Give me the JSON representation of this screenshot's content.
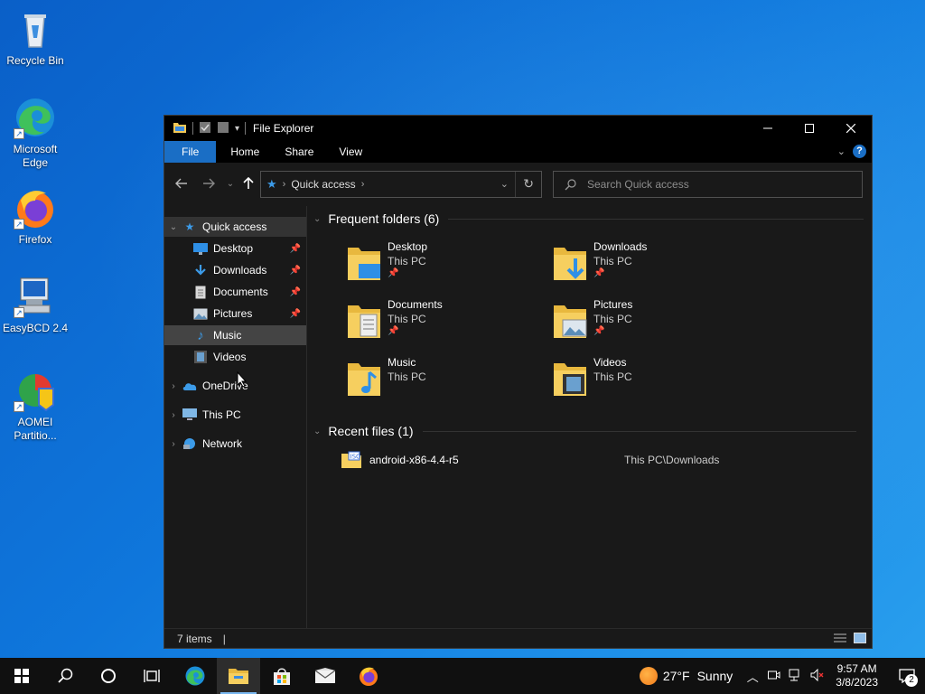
{
  "desktop": {
    "icons": [
      {
        "label": "Recycle Bin",
        "icon": "recycle-bin-icon"
      },
      {
        "label": "Microsoft Edge",
        "icon": "edge-icon"
      },
      {
        "label": "Firefox",
        "icon": "firefox-icon"
      },
      {
        "label": "EasyBCD 2.4",
        "icon": "easybcd-icon"
      },
      {
        "label": "AOMEI Partitio...",
        "icon": "aomei-icon"
      }
    ]
  },
  "window": {
    "title": "File Explorer",
    "ribbon_tabs": [
      "File",
      "Home",
      "Share",
      "View"
    ],
    "address": {
      "crumb": "Quick access"
    },
    "search": {
      "placeholder": "Search Quick access"
    },
    "sidebar": {
      "quick_access": "Quick access",
      "items": [
        {
          "label": "Desktop",
          "pinned": true,
          "icon": "desktop-icon"
        },
        {
          "label": "Downloads",
          "pinned": true,
          "icon": "downloads-icon"
        },
        {
          "label": "Documents",
          "pinned": true,
          "icon": "documents-icon"
        },
        {
          "label": "Pictures",
          "pinned": true,
          "icon": "pictures-icon"
        },
        {
          "label": "Music",
          "pinned": false,
          "icon": "music-icon"
        },
        {
          "label": "Videos",
          "pinned": false,
          "icon": "videos-icon"
        }
      ],
      "roots": [
        {
          "label": "OneDrive",
          "icon": "onedrive-icon"
        },
        {
          "label": "This PC",
          "icon": "this-pc-icon"
        },
        {
          "label": "Network",
          "icon": "network-icon"
        }
      ]
    },
    "frequent": {
      "header": "Frequent folders (6)",
      "folders": [
        {
          "name": "Desktop",
          "location": "This PC",
          "pinned": true
        },
        {
          "name": "Downloads",
          "location": "This PC",
          "pinned": true
        },
        {
          "name": "Documents",
          "location": "This PC",
          "pinned": true
        },
        {
          "name": "Pictures",
          "location": "This PC",
          "pinned": true
        },
        {
          "name": "Music",
          "location": "This PC",
          "pinned": false
        },
        {
          "name": "Videos",
          "location": "This PC",
          "pinned": false
        }
      ]
    },
    "recent": {
      "header": "Recent files (1)",
      "files": [
        {
          "name": "android-x86-4.4-r5",
          "path": "This PC\\Downloads"
        }
      ]
    },
    "status": {
      "items": "7 items",
      "cursor": "|"
    }
  },
  "taskbar": {
    "apps": [
      "start-icon",
      "search-icon",
      "cortana-icon",
      "task-view-icon",
      "edge-icon",
      "file-explorer-icon",
      "store-icon",
      "mail-icon",
      "firefox-icon"
    ],
    "weather": {
      "temp": "27°F",
      "desc": "Sunny"
    },
    "clock": {
      "time": "9:57 AM",
      "date": "3/8/2023"
    },
    "notifications": "2"
  },
  "colors": {
    "accent": "#1a6ec5",
    "folder": "#f4c855",
    "background_dark": "#191919"
  }
}
